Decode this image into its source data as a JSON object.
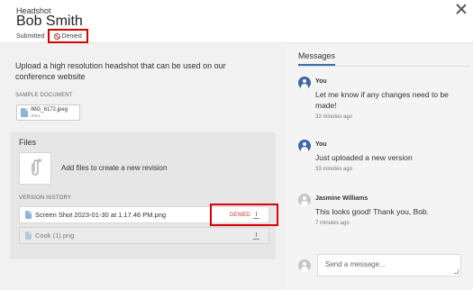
{
  "header": {
    "eyebrow": "Headshot",
    "title": "Bob Smith",
    "status_label": "Submitted",
    "status_badge": "Denied"
  },
  "upload": {
    "intro": "Upload a high resolution headshot that can be used on our conference website",
    "sample_label": "SAMPLE DOCUMENT",
    "sample_file_name": "IMG_6172.jpeg",
    "sample_file_type": "JPEG"
  },
  "files": {
    "title": "Files",
    "add_text": "Add files to create a new revision",
    "history_label": "VERSION HISTORY",
    "versions": [
      {
        "name": "Screen Shot 2023-01-30 at 1.17.46 PM.png",
        "status": "DENIED"
      },
      {
        "name": "Cook (1).png",
        "status": ""
      }
    ]
  },
  "messages": {
    "tab_label": "Messages",
    "items": [
      {
        "author": "You",
        "body": "Let me know if any changes need to be made!",
        "time": "33 minutes ago"
      },
      {
        "author": "You",
        "body": "Just uploaded a new version",
        "time": "33 minutes ago"
      },
      {
        "author": "Jasmine Williams",
        "body": "This looks good! Thank you, Bob.",
        "time": "7 minutes ago"
      }
    ],
    "composer_placeholder": "Send a message..."
  },
  "colors": {
    "accent": "#3a6fb0",
    "highlight_red": "#d90000",
    "denied_text": "#c0392b"
  },
  "icons": [
    "close-icon",
    "ban-icon",
    "file-icon",
    "paperclip-icon",
    "download-icon",
    "user-avatar-icon"
  ]
}
